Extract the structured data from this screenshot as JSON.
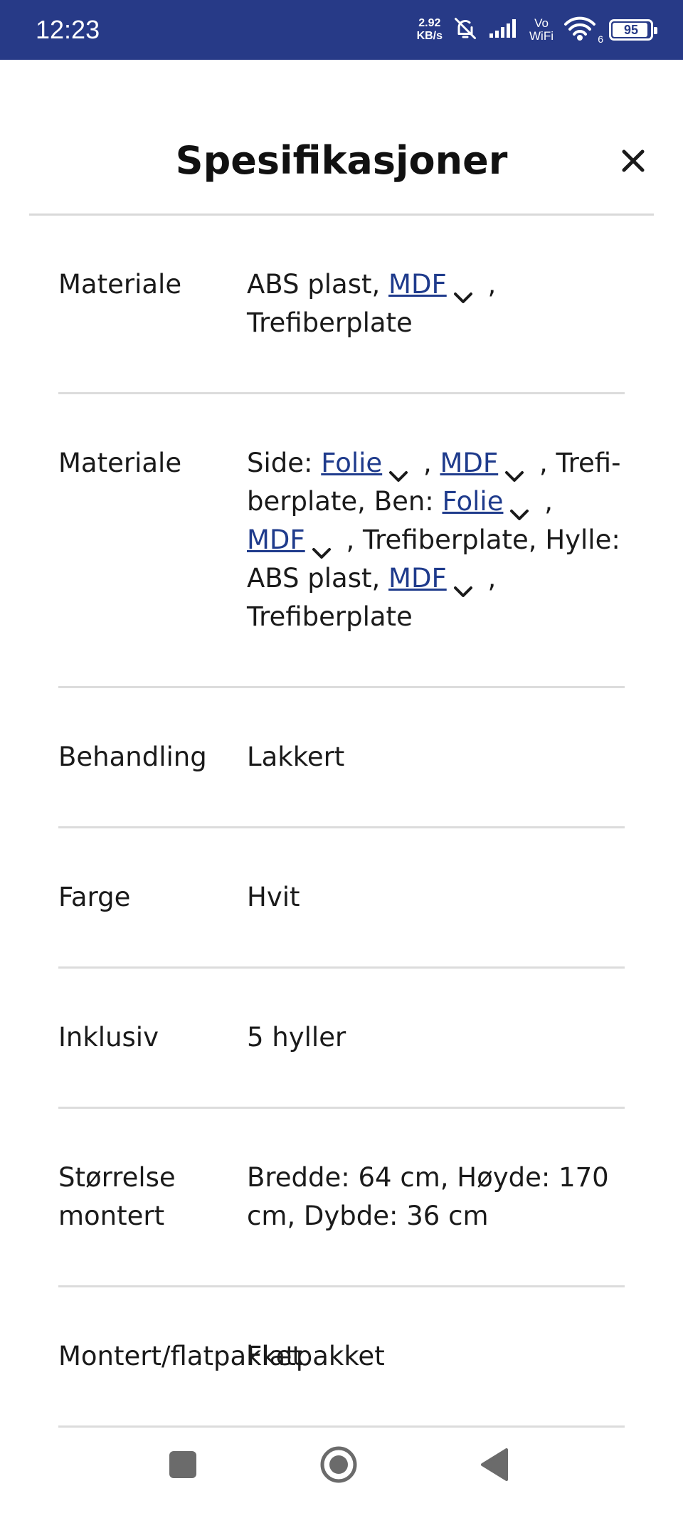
{
  "status_bar": {
    "time": "12:23",
    "net_speed_value": "2.92",
    "net_speed_unit": "KB/s",
    "vo_label": "Vo",
    "wifi_label": "WiFi",
    "wifi_sub": "6",
    "battery_level": "95",
    "bg_color": "#273a87"
  },
  "header": {
    "title": "Spesifikasjoner",
    "close_icon": "close-icon"
  },
  "specs": [
    {
      "label": "Materiale",
      "value_parts": [
        "ABS plast, ",
        "MDF",
        " , ",
        "Trefiberplate"
      ]
    },
    {
      "label": "Materiale",
      "text": {
        "side": "Side: ",
        "folie1": "Folie",
        "comma1": " , ",
        "mdf1": "MDF",
        "trefi1": " , Trefi-berplate, Ben: ",
        "folie2": "Folie",
        "comma2": " , ",
        "mdf2": "MDF",
        "trefi2": " , Trefiberplate, Hylle: ABS plast, ",
        "mdf3": "MDF",
        "comma3": " , ",
        "end": "Trefiberplate"
      }
    },
    {
      "label": "Behandling",
      "value": "Lakkert"
    },
    {
      "label": "Farge",
      "value": "Hvit"
    },
    {
      "label": "Inklusiv",
      "value": "5 hyller"
    },
    {
      "label": "Størrelse montert",
      "value": "Bredde: 64 cm, Høyde: 170 cm, Dybde: 36 cm"
    },
    {
      "label": "Montert/flatpakket",
      "value": "Flatpakket"
    }
  ],
  "nav": {
    "recents_icon": "square-icon",
    "home_icon": "circle-icon",
    "back_icon": "triangle-back-icon"
  },
  "colors": {
    "link": "#1f3b8c",
    "divider": "#dcdcdc"
  }
}
